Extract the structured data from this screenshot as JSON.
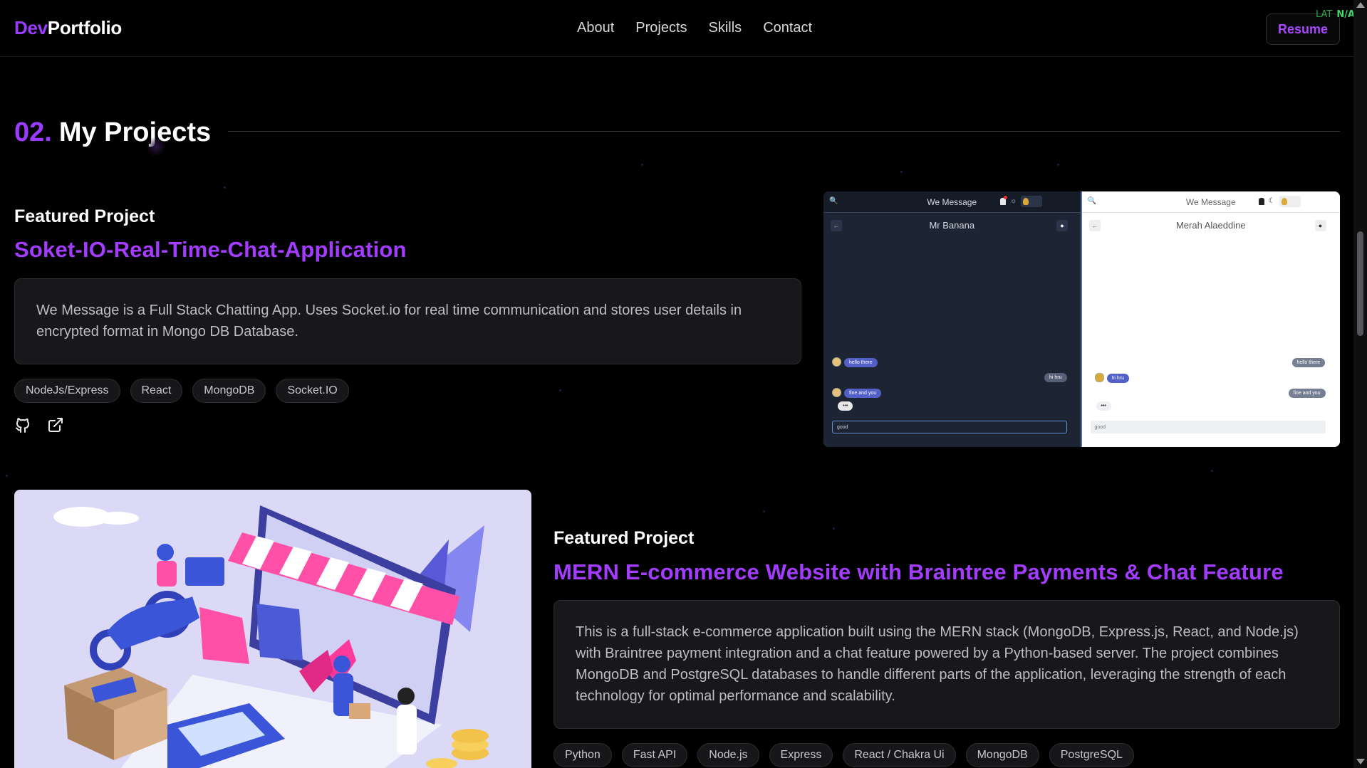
{
  "header": {
    "logo_accent": "Dev",
    "logo_main": "Portfolio",
    "nav": [
      "About",
      "Projects",
      "Skills",
      "Contact"
    ],
    "resume_label": "Resume",
    "lat_label": "LAT",
    "lat_value": "N/A"
  },
  "section": {
    "number": "02.",
    "title": "My Projects"
  },
  "projects": [
    {
      "kicker": "Featured Project",
      "title": "Soket-IO-Real-Time-Chat-Application",
      "description": "We Message is a Full Stack Chatting App. Uses Socket.io for real time communication and stores user details in encrypted format in Mongo DB Database.",
      "tags": [
        "NodeJs/Express",
        "React",
        "MongoDB",
        "Socket.IO"
      ],
      "links": [
        "github-icon",
        "external-link-icon"
      ],
      "preview": {
        "app_name": "We Message",
        "dark_chat_name": "Mr Banana",
        "light_chat_name": "Merah Alaeddine",
        "msg1": "hello there",
        "msg2": "hi hru",
        "msg3": "fine and you",
        "typing": "•••",
        "input_text": "good"
      }
    },
    {
      "kicker": "Featured Project",
      "title": "MERN E-commerce Website with Braintree Payments & Chat Feature",
      "description": "This is a full-stack e-commerce application built using the MERN stack (MongoDB, Express.js, React, and Node.js) with Braintree payment integration and a chat feature powered by a Python-based server. The project combines MongoDB and PostgreSQL databases to handle different parts of the application, leveraging the strength of each technology for optimal performance and scalability.",
      "tags": [
        "Python",
        "Fast API",
        "Node.js",
        "Express",
        "React / Chakra Ui",
        "MongoDB",
        "PostgreSQL"
      ]
    }
  ],
  "colors": {
    "accent": "#9b3bff",
    "title_purple": "#a43cff",
    "background": "#000000",
    "card": "#18181b"
  }
}
